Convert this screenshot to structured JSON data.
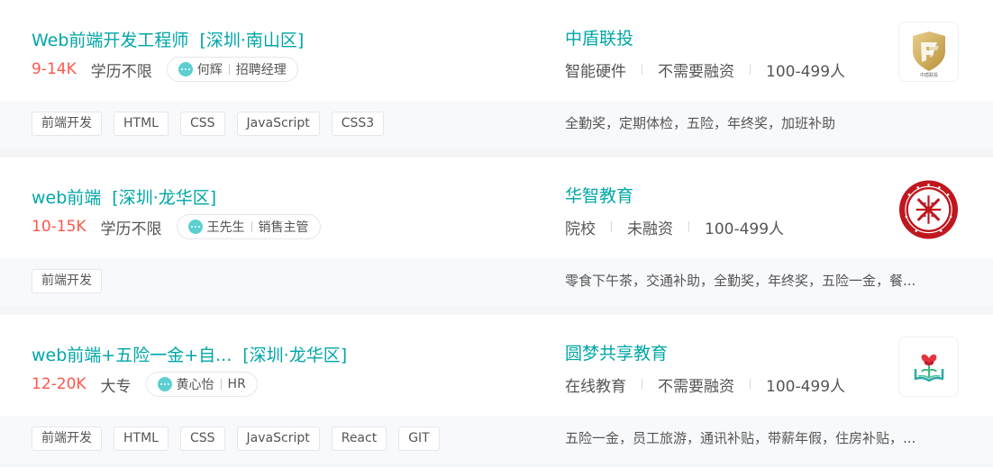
{
  "jobs": [
    {
      "title": "Web前端开发工程师",
      "area": "[深圳·南山区]",
      "salary": "9-14K",
      "education": "学历不限",
      "recruiter_name": "何辉",
      "recruiter_role": "招聘经理",
      "company": "中盾联投",
      "industry": "智能硬件",
      "financing": "不需要融资",
      "size": "100-499人",
      "logo_text": "中盾联投",
      "logo_icon": "shield-logo",
      "tags": [
        "前端开发",
        "HTML",
        "CSS",
        "JavaScript",
        "CSS3"
      ],
      "welfare": "全勤奖，定期体检，五险，年终奖，加班补助"
    },
    {
      "title": "web前端",
      "area": "[深圳·龙华区]",
      "salary": "10-15K",
      "education": "学历不限",
      "recruiter_name": "王先生",
      "recruiter_role": "销售主管",
      "company": "华智教育",
      "industry": "院校",
      "financing": "未融资",
      "size": "100-499人",
      "logo_icon": "red-seal-logo",
      "tags": [
        "前端开发"
      ],
      "welfare": "零食下午茶，交通补助，全勤奖，年终奖，五险一金，餐..."
    },
    {
      "title": "web前端+五险一金+自...",
      "area": "[深圳·龙华区]",
      "salary": "12-20K",
      "education": "大专",
      "recruiter_name": "黄心怡",
      "recruiter_role": "HR",
      "company": "圆梦共享教育",
      "industry": "在线教育",
      "financing": "不需要融资",
      "size": "100-499人",
      "logo_icon": "book-flower-logo",
      "tags": [
        "前端开发",
        "HTML",
        "CSS",
        "JavaScript",
        "React",
        "GIT"
      ],
      "welfare": "五险一金，员工旅游，通讯补贴，带薪年假，住房补贴，..."
    }
  ],
  "colors": {
    "accent": "#00a6a7",
    "salary": "#fe574a",
    "tag_border": "#e3e7ed",
    "footer_bg": "#f8f9fb"
  }
}
